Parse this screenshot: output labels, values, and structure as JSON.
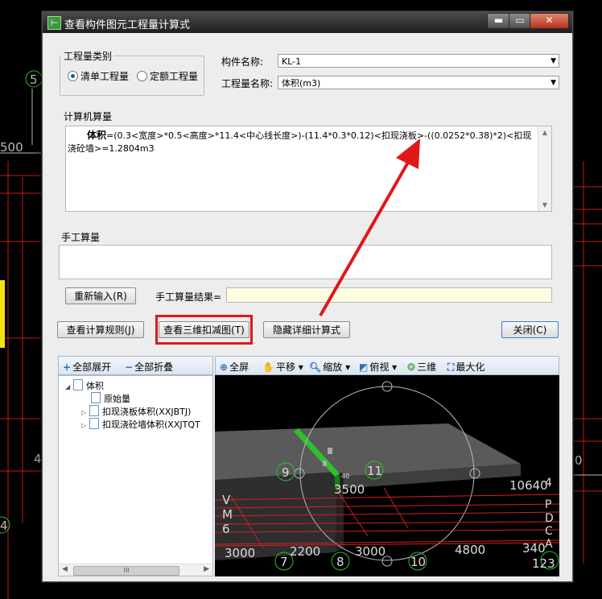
{
  "window": {
    "title": "查看构件图元工程量计算式"
  },
  "quantity_type": {
    "group_label": "工程量类别",
    "options": [
      {
        "label": "清单工程量",
        "selected": true
      },
      {
        "label": "定额工程量",
        "selected": false
      }
    ]
  },
  "component": {
    "name_label": "构件名称:",
    "name_value": "KL-1",
    "qty_label": "工程量名称:",
    "qty_value": "体积(m3)"
  },
  "computer": {
    "group_label": "计算机算量",
    "formula_name": "体积",
    "formula_line1": "=(0.3<宽度>*0.5<高度>*11.4<中心线长度>)-(11.4*0.3*0.12)<扣现浇板>-((0.0252*0.38)*2)<扣现",
    "formula_line2": "浇砼墙>=1.2804m3"
  },
  "manual": {
    "group_label": "手工算量",
    "reinput_button": "重新输入(R)",
    "result_label": "手工算量结果=",
    "result_value": ""
  },
  "actions": {
    "view_rules": "查看计算规则(J)",
    "view_3d": "查看三维扣减图(T)",
    "hide_detail": "隐藏详细计算式",
    "close": "关闭(C)"
  },
  "tree_panel": {
    "expand_all": "全部展开",
    "collapse_all": "全部折叠",
    "items": [
      {
        "label": "体积"
      },
      {
        "label": "原始量"
      },
      {
        "label": "扣现浇板体积(XXJBTJ)"
      },
      {
        "label": "扣现浇砼墙体积(XXJTQT"
      }
    ],
    "scroll_thumb": "III"
  },
  "view_toolbar": {
    "full_screen": "全屏",
    "pan": "平移",
    "zoom": "缩放",
    "top_view": "俯视",
    "three_d": "三维",
    "maximize": "最大化"
  },
  "view3d_labels": {
    "axis_9": "9",
    "axis_11": "11",
    "axis_7": "7",
    "axis_8": "8",
    "axis_10": "10",
    "dim_3500": "3500",
    "dim_10640": "10640",
    "dim_3000a": "3000",
    "dim_2200": "2200",
    "dim_3000b": "3000",
    "dim_4800": "4800",
    "dim_340": "340",
    "dim_123": "123",
    "small_40": "40",
    "letters_v": "V",
    "letters_m": "M",
    "letters_6": "6",
    "right_letters": "P",
    "right_d": "D",
    "right_c": "C",
    "right_a": "A",
    "right_4": "4"
  },
  "cad_background": {
    "label_5": "5",
    "label_500": "500",
    "label_4": "4",
    "label_4b": "4",
    "label_0": "0"
  },
  "colors": {
    "accent_red": "#e01818",
    "wall_red": "#d42020",
    "beam_green": "#2fbf2f"
  }
}
